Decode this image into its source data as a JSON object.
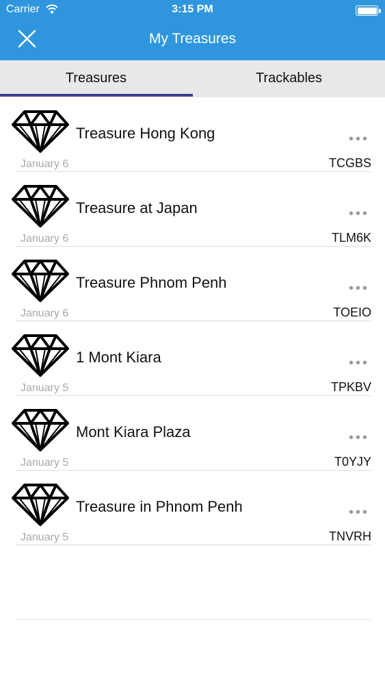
{
  "status_bar": {
    "carrier": "Carrier",
    "time": "3:15 PM"
  },
  "nav": {
    "title": "My Treasures",
    "close_icon": "close-icon"
  },
  "tabs": [
    {
      "label": "Treasures",
      "selected": true
    },
    {
      "label": "Trackables",
      "selected": false
    }
  ],
  "colors": {
    "header": "#2f96dd",
    "tab_indicator": "#3a3f8f",
    "tab_bar": "#e8e8e8"
  },
  "treasures": [
    {
      "title": "Treasure Hong Kong",
      "date": "January 6",
      "code": "TCGBS"
    },
    {
      "title": "Treasure at Japan",
      "date": "January 6",
      "code": "TLM6K"
    },
    {
      "title": "Treasure Phnom Penh",
      "date": "January 6",
      "code": "TOEIO"
    },
    {
      "title": "1 Mont Kiara",
      "date": "January 5",
      "code": "TPKBV"
    },
    {
      "title": "Mont Kiara Plaza",
      "date": "January 5",
      "code": "T0YJY"
    },
    {
      "title": "Treasure in Phnom Penh",
      "date": "January 5",
      "code": "TNVRH"
    }
  ]
}
